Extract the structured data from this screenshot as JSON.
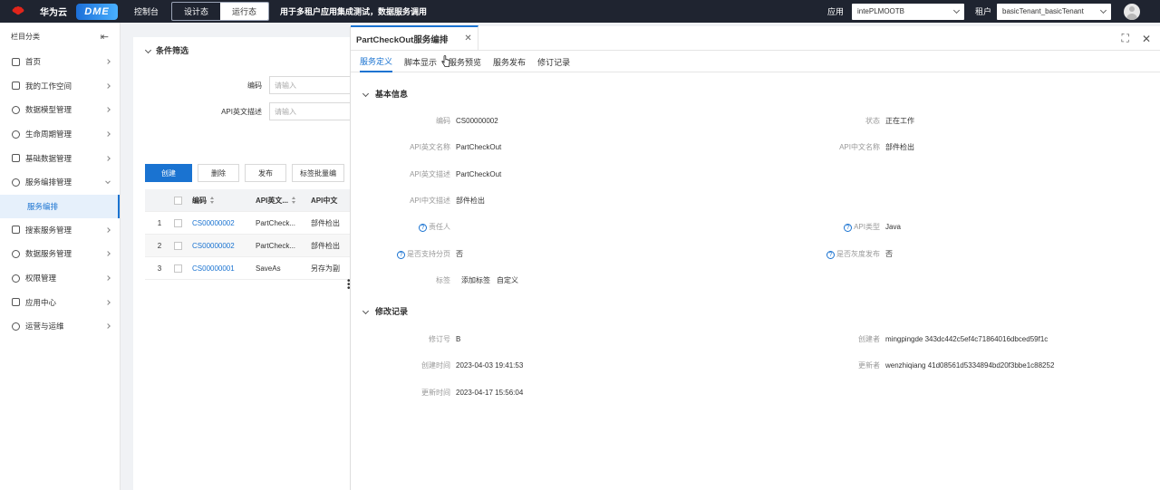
{
  "topbar": {
    "brand_logo_text": "HUAWEI",
    "brand_name": "华为云",
    "product": "DME",
    "console": "控制台",
    "mode_design": "设计态",
    "mode_run": "运行态",
    "note": "用于多租户应用集成测试，数据服务调用",
    "app_label": "应用",
    "app_value": "intePLMOOTB",
    "tenant_label": "租户",
    "tenant_value": "basicTenant_basicTenant",
    "colors": {
      "bar_bg": "#1f2430",
      "accent": "#1a73d1",
      "logo_red": "#e1251b"
    }
  },
  "sidebar": {
    "title": "栏目分类",
    "items": [
      {
        "label": "首页",
        "icon": "home-icon"
      },
      {
        "label": "我的工作空间",
        "icon": "workspace-icon"
      },
      {
        "label": "数据模型管理",
        "icon": "model-icon"
      },
      {
        "label": "生命周期管理",
        "icon": "lifecycle-icon"
      },
      {
        "label": "基础数据管理",
        "icon": "database-icon"
      },
      {
        "label": "服务编排管理",
        "icon": "orchestration-icon"
      },
      {
        "label": "搜索服务管理",
        "icon": "search-icon"
      },
      {
        "label": "数据服务管理",
        "icon": "data-service-icon"
      },
      {
        "label": "权限管理",
        "icon": "permission-icon"
      },
      {
        "label": "应用中心",
        "icon": "app-center-icon"
      },
      {
        "label": "运营与运维",
        "icon": "operations-icon"
      }
    ],
    "active_sub": "服务编排"
  },
  "main": {
    "filter_title": "条件筛选",
    "filters": [
      {
        "label": "编码",
        "placeholder": "请输入"
      },
      {
        "label": "API英文描述",
        "placeholder": "请输入"
      }
    ],
    "buttons": {
      "create": "创建",
      "delete": "删除",
      "publish": "发布",
      "batch_tag": "标签批量编"
    },
    "table": {
      "headers": [
        "编码",
        "API英文...",
        "API中文"
      ],
      "rows": [
        {
          "index": "1",
          "code": "CS00000002",
          "api_en": "PartCheck...",
          "api_cn": "部件检出"
        },
        {
          "index": "2",
          "code": "CS00000002",
          "api_en": "PartCheck...",
          "api_cn": "部件检出"
        },
        {
          "index": "3",
          "code": "CS00000001",
          "api_en": "SaveAs",
          "api_cn": "另存为副"
        }
      ]
    }
  },
  "drawer": {
    "tab_title": "PartCheckOut服务编排",
    "sub_tabs": [
      "服务定义",
      "脚本显示",
      "服务预览",
      "服务发布",
      "修订记录"
    ],
    "basic_info": {
      "title": "基本信息",
      "code_label": "编码",
      "code_value": "CS00000002",
      "status_label": "状态",
      "status_value": "正在工作",
      "api_en_name_label": "API英文名称",
      "api_en_name_value": "PartCheckOut",
      "api_cn_name_label": "API中文名称",
      "api_cn_name_value": "部件检出",
      "api_en_desc_label": "API英文描述",
      "api_en_desc_value": "PartCheckOut",
      "api_cn_desc_label": "API中文描述",
      "api_cn_desc_value": "部件检出",
      "owner_label": "责任人",
      "api_type_label": "API类型",
      "api_type_value": "Java",
      "paging_label": "是否支持分页",
      "paging_value": "否",
      "gray_label": "是否灰度发布",
      "gray_value": "否",
      "tag_label": "标签",
      "add_tag": "添加标签",
      "custom_tag": "自定义"
    },
    "revision": {
      "title": "修改记录",
      "rev_label": "修订号",
      "rev_value": "B",
      "creator_label": "创建者",
      "creator_value": "mingpingde 343dc442c5ef4c71864016dbced59f1c",
      "created_label": "创建时间",
      "created_value": "2023-04-03 19:41:53",
      "updater_label": "更新者",
      "updater_value": "wenzhiqiang 41d08561d5334894bd20f3bbe1c88252",
      "updated_label": "更新时间",
      "updated_value": "2023-04-17 15:56:04"
    }
  }
}
